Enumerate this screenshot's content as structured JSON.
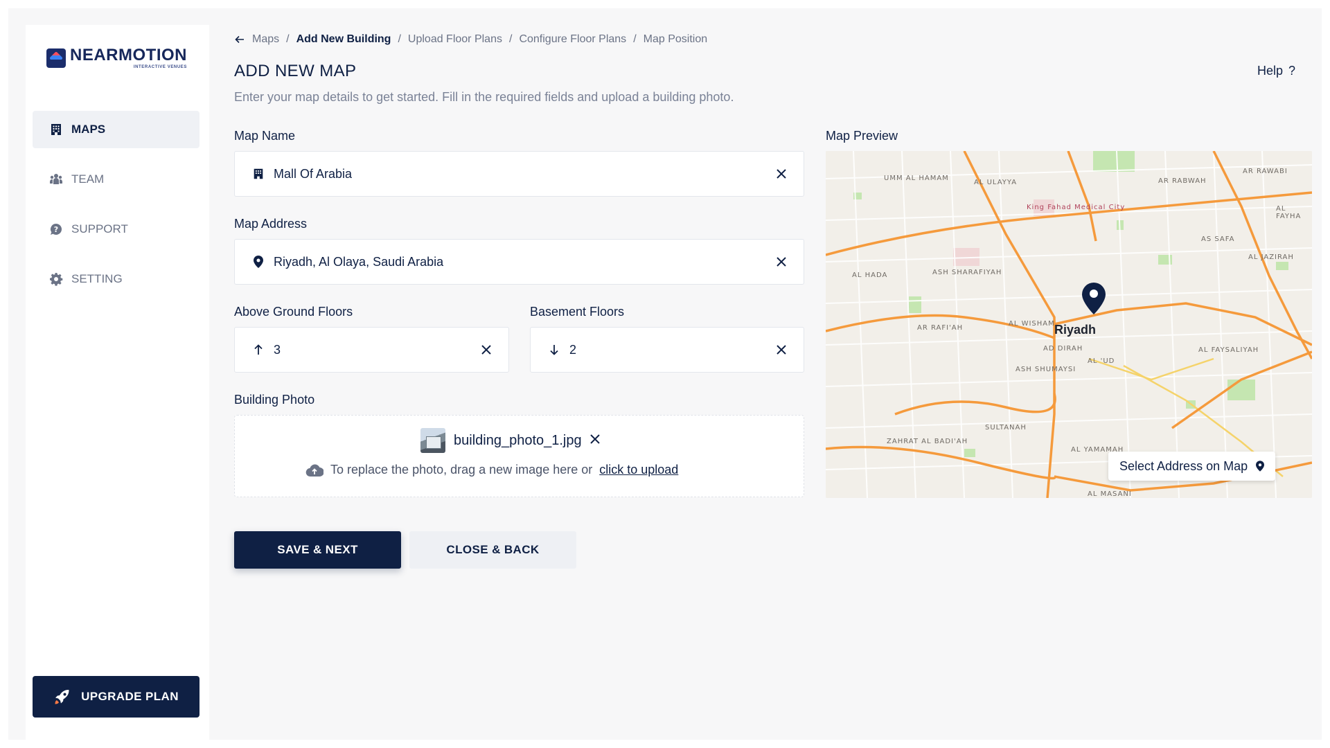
{
  "brand": {
    "name": "NEARMOTION",
    "tagline": "INTERACTIVE VENUES"
  },
  "sidebar": {
    "items": [
      {
        "label": "MAPS",
        "icon": "building-icon",
        "active": true
      },
      {
        "label": "TEAM",
        "icon": "team-icon",
        "active": false
      },
      {
        "label": "SUPPORT",
        "icon": "support-icon",
        "active": false
      },
      {
        "label": "SETTING",
        "icon": "gear-icon",
        "active": false
      }
    ],
    "upgrade_label": "UPGRADE PLAN"
  },
  "breadcrumb": {
    "items": [
      "Maps",
      "Add New Building",
      "Upload Floor Plans",
      "Configure Floor Plans",
      "Map Position"
    ],
    "separator": "/"
  },
  "header": {
    "title": "ADD NEW MAP",
    "help_label": "Help",
    "help_icon": "?",
    "subtitle": "Enter your map details to get started. Fill in the required fields and upload a building photo."
  },
  "form": {
    "map_name": {
      "label": "Map Name",
      "value": "Mall Of Arabia"
    },
    "map_address": {
      "label": "Map Address",
      "value": "Riyadh, Al Olaya, Saudi Arabia"
    },
    "above_ground": {
      "label": "Above Ground Floors",
      "value": "3"
    },
    "basement": {
      "label": "Basement Floors",
      "value": "2"
    },
    "building_photo": {
      "label": "Building Photo",
      "file_name": "building_photo_1.jpg",
      "replace_text": "To replace the photo, drag a new image here or",
      "upload_link": "click to upload"
    }
  },
  "actions": {
    "save_label": "SAVE & NEXT",
    "close_label": "CLOSE & BACK"
  },
  "preview": {
    "label": "Map Preview",
    "city": "Riyadh",
    "select_label": "Select Address on Map",
    "map_labels": [
      "UMM AL HAMAM",
      "AL ULAYYA",
      "AR RABWAH",
      "AR RAWABI",
      "AL FAYHA",
      "AS SAFA",
      "AL JAZIRAH",
      "AL HADA",
      "ASH SHARAFIYAH",
      "AR RAFI'AH",
      "AL WISHAM",
      "AD DIRAH",
      "AL 'UD",
      "ASH SHUMAYSI",
      "AL FAYSALIYAH",
      "SULTANAH",
      "ZAHRAT AL BADI'AH",
      "AL YAMAMAH",
      "AL MASANI",
      "King Fahad Medical City"
    ]
  },
  "colors": {
    "primary": "#0f2044",
    "accent_road": "#f59a3c",
    "map_bg": "#f2efe9",
    "park": "#bfe3a9"
  }
}
